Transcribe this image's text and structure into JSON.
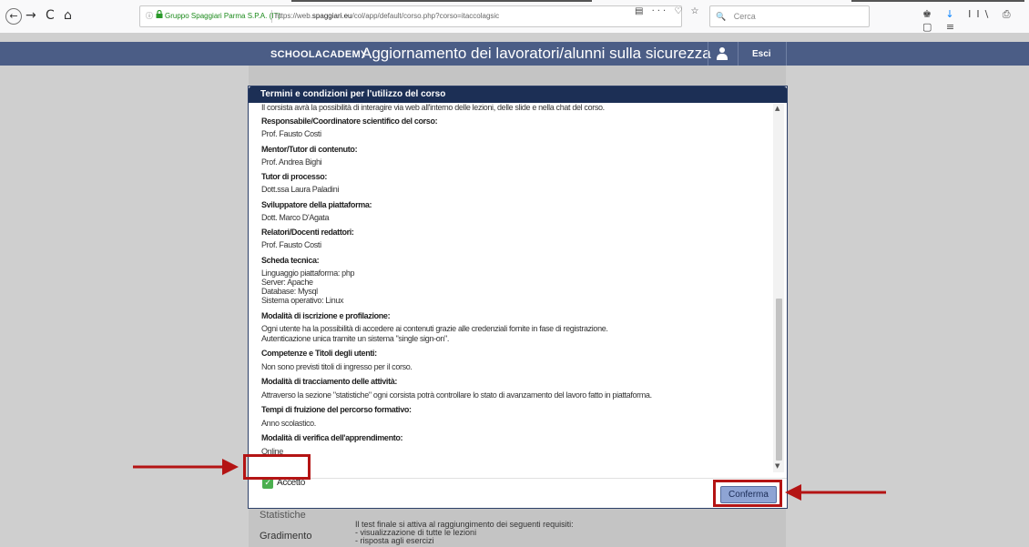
{
  "browser": {
    "back_icon": "←",
    "forward_icon": "→",
    "reload_icon": "C",
    "home_icon": "⌂",
    "info_icon": "ⓘ",
    "lock_icon": "🔒",
    "site_identity": "Gruppo Spaggiari Parma S.P.A. (IT)",
    "url_prefix": "https://web.",
    "url_domain": "spaggiari.eu",
    "url_suffix": "/col/app/default/corso.php?corso=itaccolagsic",
    "url_actions": "▤ ··· ♡ ☆",
    "search_placeholder": "Cerca",
    "toolbar_icons_a": "♚",
    "toolbar_icons_b": "↓ ⅡⅠ ⎙ ▢ ≡"
  },
  "header": {
    "logo": "SCHOOLACADEMY",
    "title": "Aggiornamento dei lavoratori/alunni sulla sicurezza",
    "logout": "Esci"
  },
  "modal": {
    "title": "Termini e condizioni per l'utilizzo del corso",
    "lines": [
      {
        "text": "Il corsista avrà la possibilità di interagire via web all'interno delle lezioni, delle slide e nella chat del corso.",
        "bold": false
      },
      {
        "text": "Responsabile/Coordinatore scientifico del corso:",
        "bold": true
      },
      {
        "text": "Prof. Fausto Costi",
        "bold": false
      },
      {
        "text": "Mentor/Tutor di contenuto:",
        "bold": true
      },
      {
        "text": "Prof. Andrea Bighi",
        "bold": false
      },
      {
        "text": "Tutor di processo:",
        "bold": true
      },
      {
        "text": "Dott.ssa Laura Paladini",
        "bold": false
      },
      {
        "text": "Sviluppatore della piattaforma:",
        "bold": true
      },
      {
        "text": "Dott. Marco D'Agata",
        "bold": false
      },
      {
        "text": "Relatori/Docenti redattori:",
        "bold": true
      },
      {
        "text": "Prof. Fausto Costi",
        "bold": false
      },
      {
        "text": "Scheda tecnica:",
        "bold": true
      },
      {
        "text": "Linguaggio piattaforma: php",
        "bold": false
      },
      {
        "text": "Server: Apache",
        "bold": false
      },
      {
        "text": "Database: Mysql",
        "bold": false
      },
      {
        "text": "Sistema operativo: Linux",
        "bold": false
      },
      {
        "text": "Modalità di iscrizione e profilazione:",
        "bold": true
      },
      {
        "text": "Ogni utente ha la possibilità di accedere ai contenuti grazie alle credenziali fornite in fase di registrazione.",
        "bold": false
      },
      {
        "text": "Autenticazione unica tramite un sistema \"single sign-on\".",
        "bold": false
      },
      {
        "text": "Competenze e Titoli degli utenti:",
        "bold": true
      },
      {
        "text": "Non sono previsti titoli di ingresso per il corso.",
        "bold": false
      },
      {
        "text": "Modalità di tracciamento delle attività:",
        "bold": true
      },
      {
        "text": "Attraverso la sezione \"statistiche\" ogni corsista potrà controllare lo stato di avanzamento del lavoro fatto in piattaforma.",
        "bold": false
      },
      {
        "text": "Tempi di fruizione del percorso formativo:",
        "bold": true
      },
      {
        "text": "Anno scolastico.",
        "bold": false
      },
      {
        "text": "Modalità di verifica dell'apprendimento:",
        "bold": true
      },
      {
        "text": "Online",
        "bold": false
      }
    ],
    "accept_label": "Accetto",
    "accept_checked": true,
    "confirm_label": "Conferma"
  },
  "page": {
    "side_items": [
      "Statistiche",
      "Gradimento"
    ],
    "requirements": [
      "Il test finale si attiva al raggiungimento dei seguenti requisiti:",
      "- visualizzazione di tutte le lezioni",
      "- risposta agli esercizi"
    ]
  },
  "annotations": {
    "color": "#b41414"
  }
}
